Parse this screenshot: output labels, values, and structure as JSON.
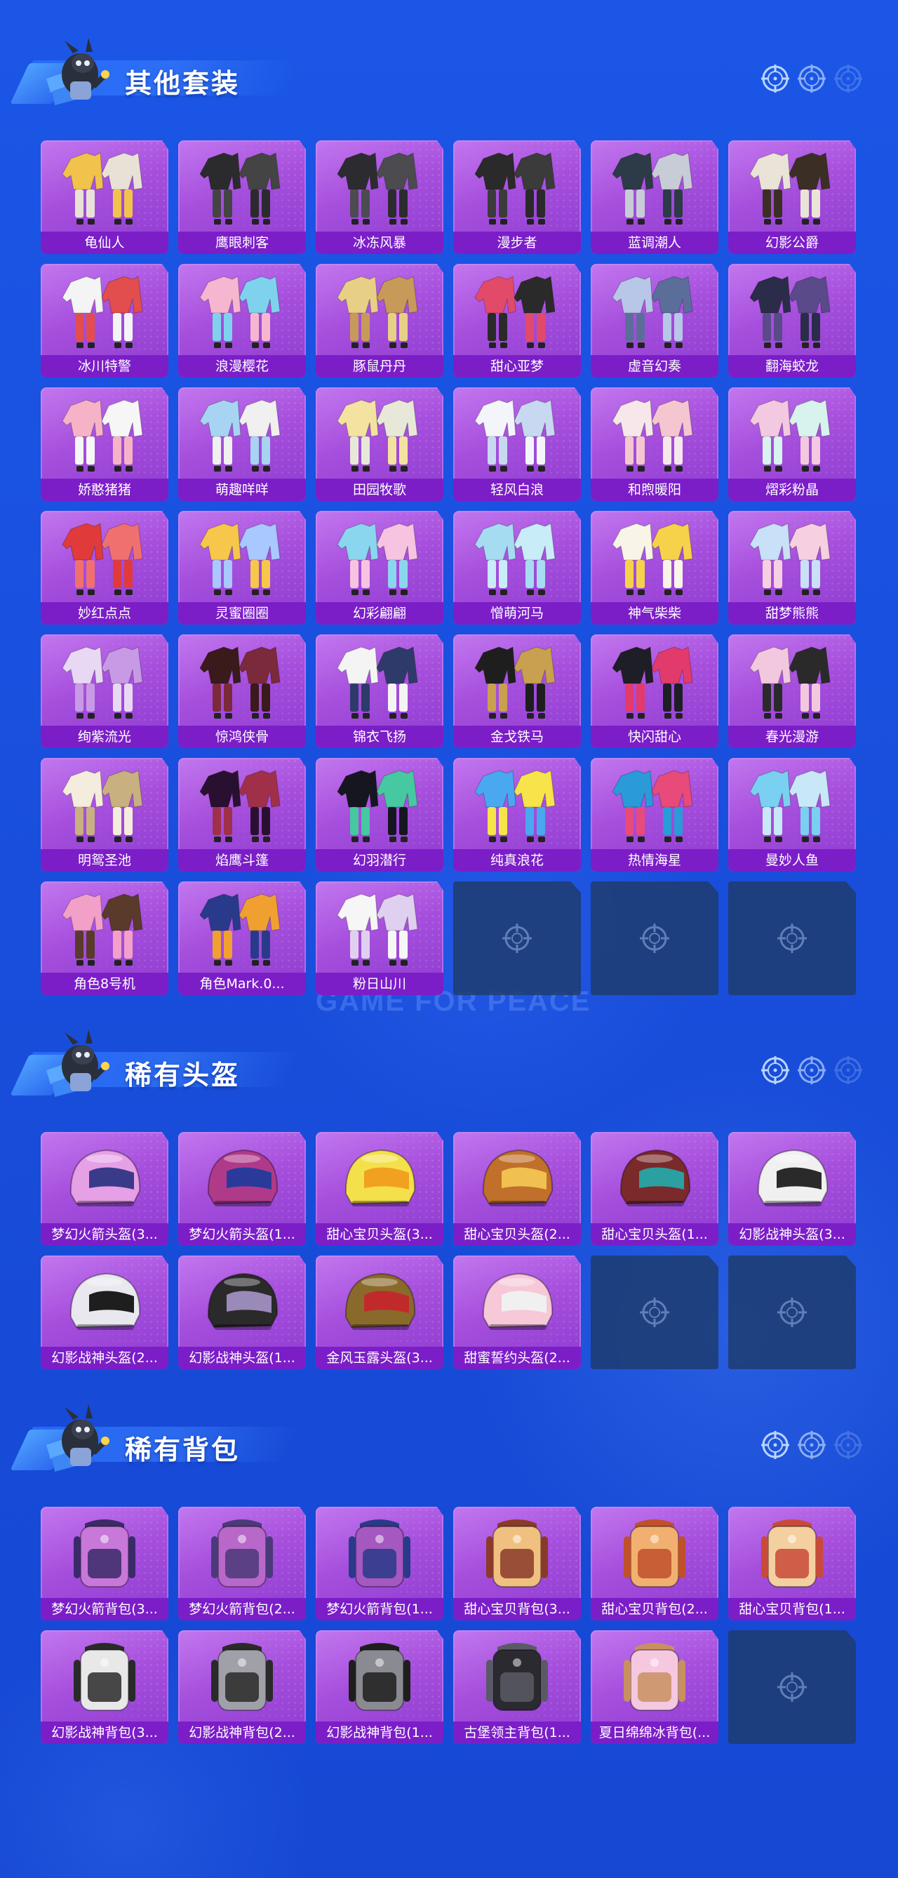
{
  "colors": {
    "accent": "#7b1ec8",
    "card": "#a64fdd",
    "empty": "#1e3c6e",
    "background": "#1a50df"
  },
  "sections": [
    {
      "title": "其他套装",
      "icon": "mascot-icon",
      "items": [
        "龟仙人",
        "鹰眼刺客",
        "冰冻风暴",
        "漫步者",
        "蓝调潮人",
        "幻影公爵",
        "冰川特警",
        "浪漫樱花",
        "豚鼠丹丹",
        "甜心亚梦",
        "虚音幻奏",
        "翻海蛟龙",
        "娇憨猪猪",
        "萌趣咩咩",
        "田园牧歌",
        "轻风白浪",
        "和煦暖阳",
        "熠彩粉晶",
        "妙红点点",
        "灵蜜圈圈",
        "幻彩翩翩",
        "憎萌河马",
        "神气柴柴",
        "甜梦熊熊",
        "绚紫流光",
        "惊鸿侠骨",
        "锦衣飞扬",
        "金戈铁马",
        "快闪甜心",
        "春光漫游",
        "明鸳圣池",
        "焰鹰斗篷",
        "幻羽潜行",
        "纯真浪花",
        "热情海星",
        "曼妙人鱼",
        "角色8号机",
        "角色Mark.0...",
        "粉日山川"
      ],
      "empty_slots": 3
    },
    {
      "title": "稀有头盔",
      "icon": "mascot-icon",
      "items": [
        "梦幻火箭头盔(3...",
        "梦幻火箭头盔(1...",
        "甜心宝贝头盔(3...",
        "甜心宝贝头盔(2...",
        "甜心宝贝头盔(1...",
        "幻影战神头盔(3...",
        "幻影战神头盔(2...",
        "幻影战神头盔(1...",
        "金风玉露头盔(3...",
        "甜蜜誓约头盔(2..."
      ],
      "empty_slots": 2
    },
    {
      "title": "稀有背包",
      "icon": "mascot-icon",
      "items": [
        "梦幻火箭背包(3...",
        "梦幻火箭背包(2...",
        "梦幻火箭背包(1...",
        "甜心宝贝背包(3...",
        "甜心宝贝背包(2...",
        "甜心宝贝背包(1...",
        "幻影战神背包(3...",
        "幻影战神背包(2...",
        "幻影战神背包(1...",
        "古堡领主背包(1...",
        "夏日绵绵冰背包(..."
      ],
      "empty_slots": 1
    }
  ],
  "watermark": "GAME FOR PEACE"
}
